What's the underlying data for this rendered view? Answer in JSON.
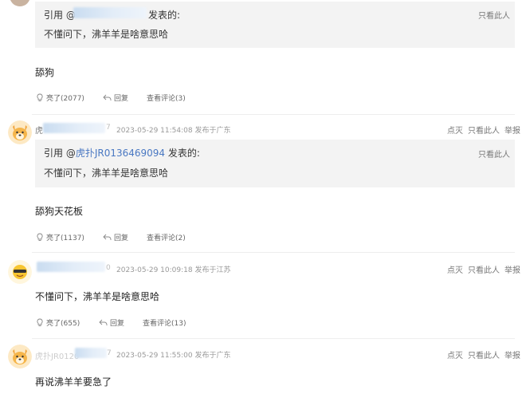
{
  "ui": {
    "quote_prefix": "引用 @",
    "quote_suffix": "发表的:",
    "only_this_person": "只看此人",
    "extinguish": "点灭",
    "report": "举报",
    "reply": "回复"
  },
  "comments": [
    {
      "quote": {
        "user": "",
        "text": "不懂问下，沸羊羊是啥意思哈"
      },
      "body": "舔狗",
      "likes_label": "亮了(2077)",
      "view_reviews_label": "查看评论(3)"
    },
    {
      "username_fragment": "虎",
      "username_tail": "7",
      "timestamp": "2023-05-29 11:54:08",
      "location": "发布于广东",
      "quote": {
        "user": "虎扑JR0136469094",
        "text": "不懂问下，沸羊羊是啥意思哈"
      },
      "body": "舔狗天花板",
      "likes_label": "亮了(1137)",
      "view_reviews_label": "查看评论(2)"
    },
    {
      "username_tail": "0",
      "timestamp": "2023-05-29 10:09:18",
      "location": "发布于江苏",
      "body": "不懂问下，沸羊羊是啥意思哈",
      "likes_label": "亮了(655)",
      "view_reviews_label": "查看评论(13)"
    },
    {
      "username_fragment": "虎扑JR0120",
      "username_tail": "7",
      "timestamp": "2023-05-29 11:55:00",
      "location": "发布于广东",
      "body": "再说沸羊羊要急了"
    }
  ],
  "icons": [
    "avatar-top-icon",
    "lightbulb-icon",
    "reply-arrow-icon",
    "dog-avatar-icon",
    "sun-avatar-icon"
  ]
}
